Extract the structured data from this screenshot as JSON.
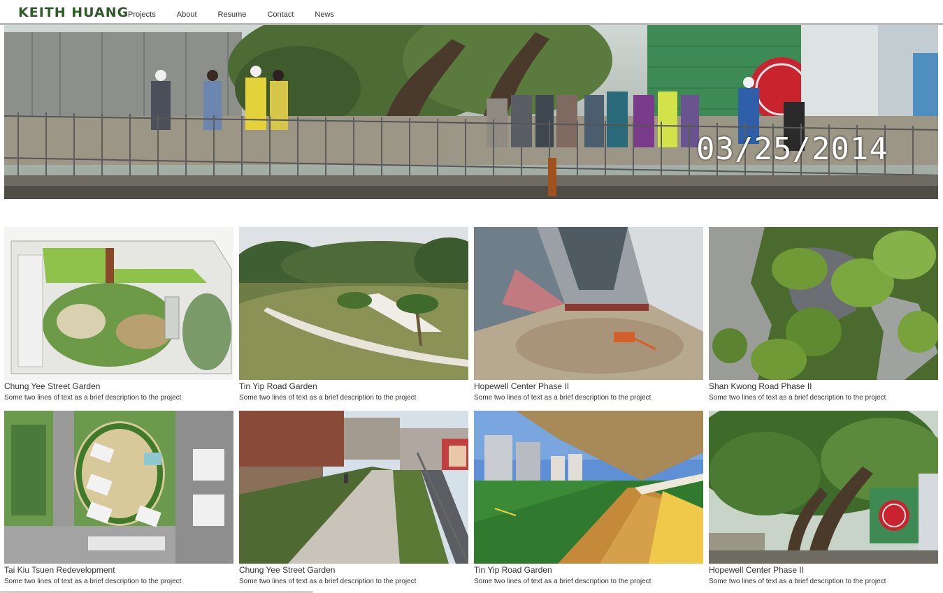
{
  "header": {
    "logo": "KEITH HUANG",
    "nav": [
      "Projects",
      "About",
      "Resume",
      "Contact",
      "News"
    ]
  },
  "hero": {
    "date_overlay": "03/25/2014"
  },
  "projects": [
    {
      "title": "Chung Yee Street Garden",
      "desc": "Some two lines of text as a brief description to the project"
    },
    {
      "title": "Tin Yip Road Garden",
      "desc": "Some two lines of text as a brief description to the project"
    },
    {
      "title": "Hopewell Center Phase II",
      "desc": "Some two lines of text as a brief description to the project"
    },
    {
      "title": "Shan Kwong Road Phase II",
      "desc": "Some two lines of text as a brief description to the project"
    },
    {
      "title": "Tai Kiu Tsuen Redevelopment",
      "desc": "Some two lines of text as a brief description to the project"
    },
    {
      "title": "Chung Yee Street Garden",
      "desc": "Some two lines of text as a brief description to the project"
    },
    {
      "title": "Tin Yip Road Garden",
      "desc": "Some two lines of text as a brief description to the project"
    },
    {
      "title": "Hopewell Center Phase II",
      "desc": "Some two lines of text as a brief description to the project"
    }
  ],
  "colors": {
    "brand": "#2f5a2a",
    "text": "#333333",
    "rule": "#bbbbbb"
  }
}
